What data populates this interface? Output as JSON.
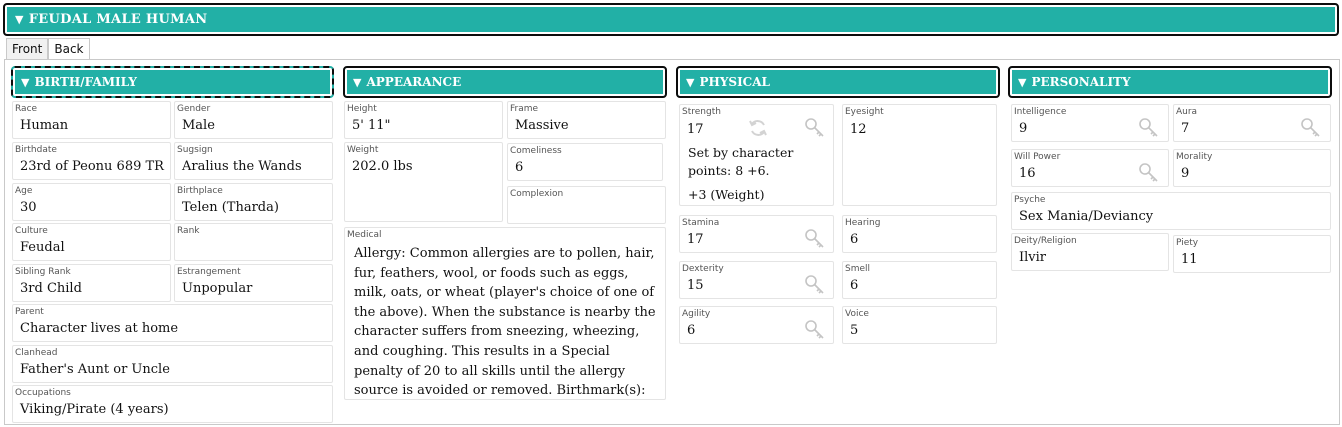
{
  "banner": {
    "title": "FEUDAL MALE HUMAN"
  },
  "tabs": [
    {
      "label": "Front"
    },
    {
      "label": "Back"
    }
  ],
  "sections": {
    "birth": "BIRTH/FAMILY",
    "appearance": "APPEARANCE",
    "physical": "PHYSICAL",
    "personality": "PERSONALITY"
  },
  "birth": {
    "race": {
      "label": "Race",
      "value": "Human"
    },
    "gender": {
      "label": "Gender",
      "value": "Male"
    },
    "birthdate": {
      "label": "Birthdate",
      "value": "23rd of Peonu 689 TR"
    },
    "sugsign": {
      "label": "Sugsign",
      "value": "Aralius the Wands"
    },
    "age": {
      "label": "Age",
      "value": "30"
    },
    "birthplace": {
      "label": "Birthplace",
      "value": "Telen (Tharda)"
    },
    "culture": {
      "label": "Culture",
      "value": "Feudal"
    },
    "rank": {
      "label": "Rank",
      "value": ""
    },
    "sibling_rank": {
      "label": "Sibling Rank",
      "value": "3rd Child"
    },
    "estrangement": {
      "label": "Estrangement",
      "value": "Unpopular"
    },
    "parent": {
      "label": "Parent",
      "value": "Character lives at home"
    },
    "clanhead": {
      "label": "Clanhead",
      "value": "Father's Aunt or Uncle"
    },
    "occupations": {
      "label": "Occupations",
      "value": "Viking/Pirate (4 years)"
    }
  },
  "appearance": {
    "height": {
      "label": "Height",
      "value": "5' 11\""
    },
    "frame": {
      "label": "Frame",
      "value": "Massive"
    },
    "weight": {
      "label": "Weight",
      "value": "202.0 lbs"
    },
    "comeliness": {
      "label": "Comeliness",
      "value": "6"
    },
    "complexion": {
      "label": "Complexion",
      "value": ""
    },
    "medical": {
      "label": "Medical",
      "value": "Allergy: Common allergies are to pollen, hair, fur, feathers, wool, or foods such as eggs, milk, oats, or wheat (player's choice of one of the above). When the substance is nearby the character suffers from sneezing, wheezing, and coughing. This results in a Special penalty of 20 to all skills until the allergy source is avoided or removed. Birthmark(s):"
    }
  },
  "physical": {
    "strength": {
      "label": "Strength",
      "value": "17",
      "note": "Set by character points: 8 +6.",
      "note2": "+3 (Weight)"
    },
    "eyesight": {
      "label": "Eyesight",
      "value": "12"
    },
    "stamina": {
      "label": "Stamina",
      "value": "17"
    },
    "hearing": {
      "label": "Hearing",
      "value": "6"
    },
    "dexterity": {
      "label": "Dexterity",
      "value": "15"
    },
    "smell": {
      "label": "Smell",
      "value": "6"
    },
    "agility": {
      "label": "Agility",
      "value": "6"
    },
    "voice": {
      "label": "Voice",
      "value": "5"
    }
  },
  "personality": {
    "intelligence": {
      "label": "Intelligence",
      "value": "9"
    },
    "aura": {
      "label": "Aura",
      "value": "7"
    },
    "will_power": {
      "label": "Will Power",
      "value": "16"
    },
    "morality": {
      "label": "Morality",
      "value": "9"
    },
    "psyche": {
      "label": "Psyche",
      "value": "Sex Mania/Deviancy"
    },
    "deity": {
      "label": "Deity/Religion",
      "value": "Ilvir"
    },
    "piety": {
      "label": "Piety",
      "value": "11"
    }
  },
  "icons": {
    "lock": "key-icon",
    "reroll": "refresh-icon",
    "collapse": "triangle-down-icon"
  },
  "colors": {
    "accent": "#22b0a6",
    "border": "#0c0c0c"
  }
}
